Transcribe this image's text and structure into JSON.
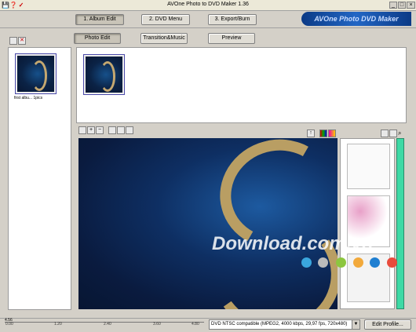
{
  "window": {
    "title": "AVOne Photo to DVD Maker 1.36",
    "min": "_",
    "max": "□",
    "close": "×"
  },
  "quick_icons": {
    "save": "💾",
    "help": "❓",
    "check": "✓"
  },
  "main_tabs": [
    {
      "label": "1. Album Edit"
    },
    {
      "label": "2. DVD Menu"
    },
    {
      "label": "3. Export/Burn"
    }
  ],
  "logo_text": "AVOne Photo DVD Maker",
  "sub_tabs": [
    {
      "label": "Photo Edit"
    },
    {
      "label": "Transition&Music"
    },
    {
      "label": "Preview"
    }
  ],
  "album": {
    "caption": "first albu... 1pics"
  },
  "watermark": {
    "text": "Download.com.vn"
  },
  "watermark_dots": [
    "#3aa6dd",
    "#bbbbbb",
    "#8cc63f",
    "#f2a93b",
    "#1f7fd1",
    "#e94b3c"
  ],
  "ruler": {
    "labels": [
      "0.00",
      "1.20",
      "2.40",
      "3.60",
      "4.80"
    ],
    "top_label": "4.56"
  },
  "profile": {
    "value": "DVD NTSC compatible (MPEG2, 4000 kbps, 29,97 fps, 720x480)",
    "edit_label": "Edit Profile..."
  },
  "colors": {
    "accent_scroll": "#3ed9a5",
    "logo_blue": "#0b3a86"
  }
}
